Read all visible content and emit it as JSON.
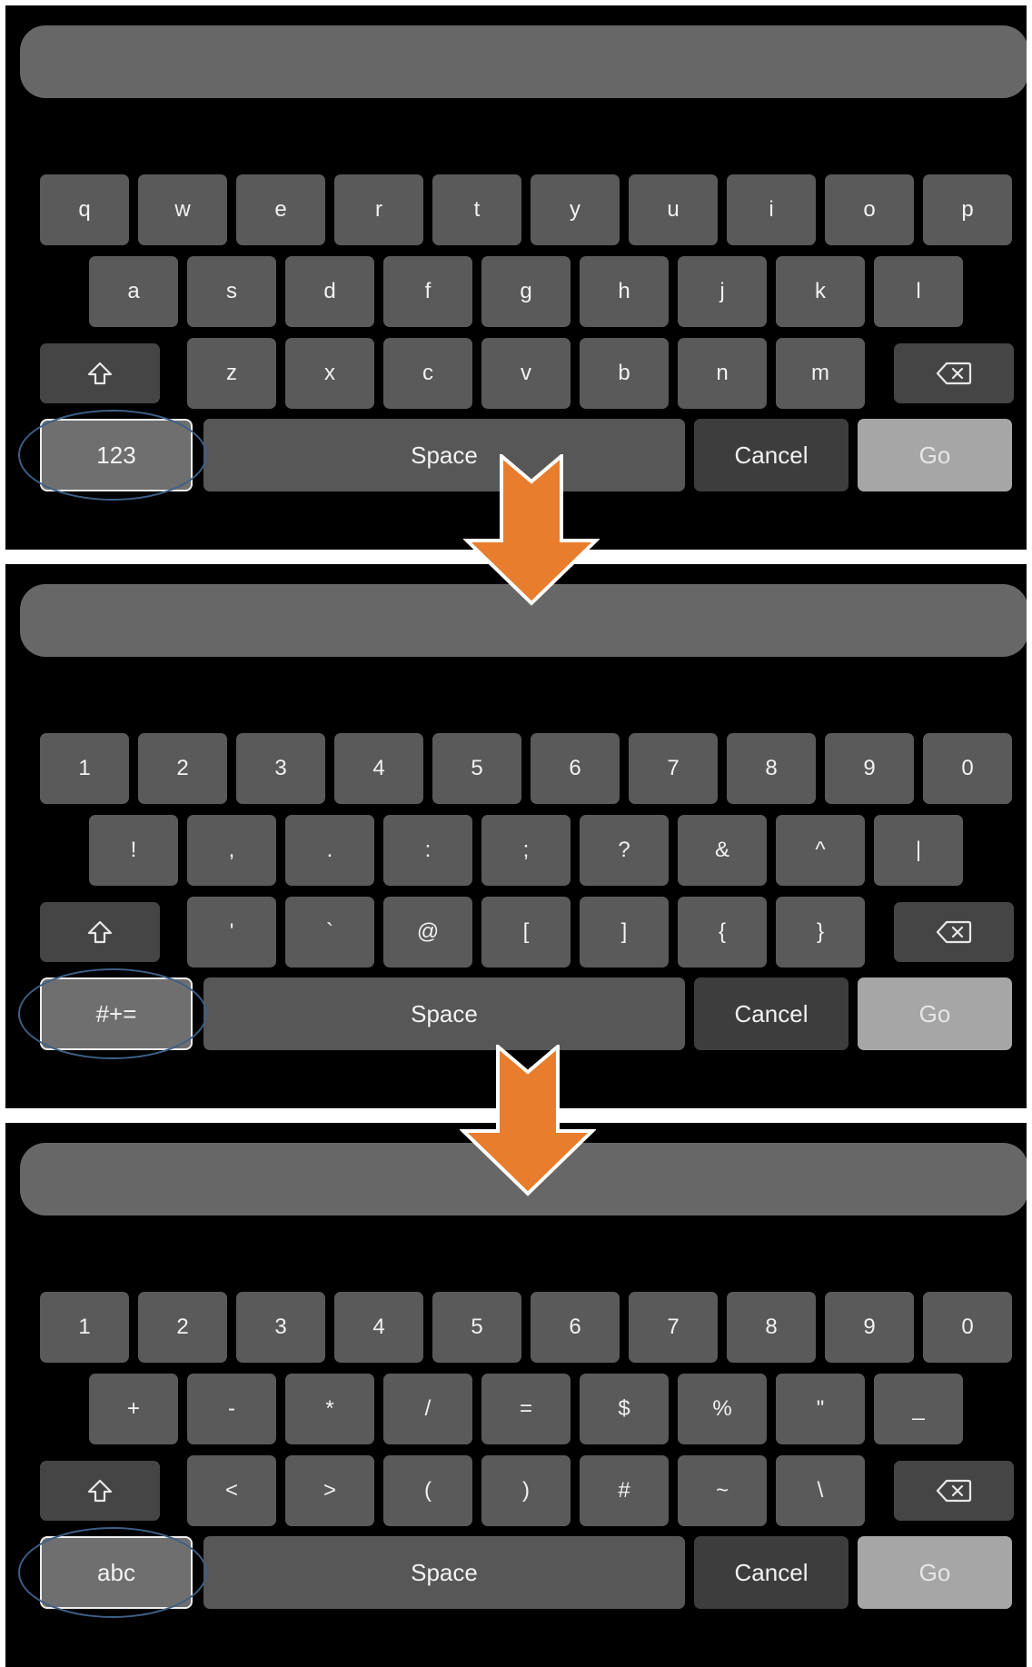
{
  "panels": [
    {
      "rows": [
        [
          "q",
          "w",
          "e",
          "r",
          "t",
          "y",
          "u",
          "i",
          "o",
          "p"
        ],
        [
          "a",
          "s",
          "d",
          "f",
          "g",
          "h",
          "j",
          "k",
          "l"
        ],
        [
          "z",
          "x",
          "c",
          "v",
          "b",
          "n",
          "m"
        ]
      ],
      "toggle_label": "123",
      "space_label": "Space",
      "cancel_label": "Cancel",
      "go_label": "Go"
    },
    {
      "rows": [
        [
          "1",
          "2",
          "3",
          "4",
          "5",
          "6",
          "7",
          "8",
          "9",
          "0"
        ],
        [
          "!",
          ",",
          ".",
          ":",
          ";",
          "?",
          "&",
          "^",
          "|"
        ],
        [
          "'",
          "`",
          "@",
          "[",
          "]",
          "{",
          "}"
        ]
      ],
      "toggle_label": "#+=",
      "space_label": "Space",
      "cancel_label": "Cancel",
      "go_label": "Go"
    },
    {
      "rows": [
        [
          "1",
          "2",
          "3",
          "4",
          "5",
          "6",
          "7",
          "8",
          "9",
          "0"
        ],
        [
          "+",
          "-",
          "*",
          "/",
          "=",
          "$",
          "%",
          "\"",
          "_"
        ],
        [
          "<",
          ">",
          "(",
          ")",
          "#",
          "~",
          "\\"
        ]
      ],
      "toggle_label": "abc",
      "space_label": "Space",
      "cancel_label": "Cancel",
      "go_label": "Go"
    }
  ],
  "icons": {
    "shift": "shift-icon",
    "backspace": "backspace-icon",
    "step_arrow": "down-arrow-icon"
  },
  "colors": {
    "panel_background": "#000000",
    "key": "#5a5a5a",
    "key_text": "#f2f2f2",
    "function_key": "#454545",
    "go_key": "#a6a6a6",
    "highlight_ring": "#3d5f86",
    "arrow": "#e87d2d"
  }
}
